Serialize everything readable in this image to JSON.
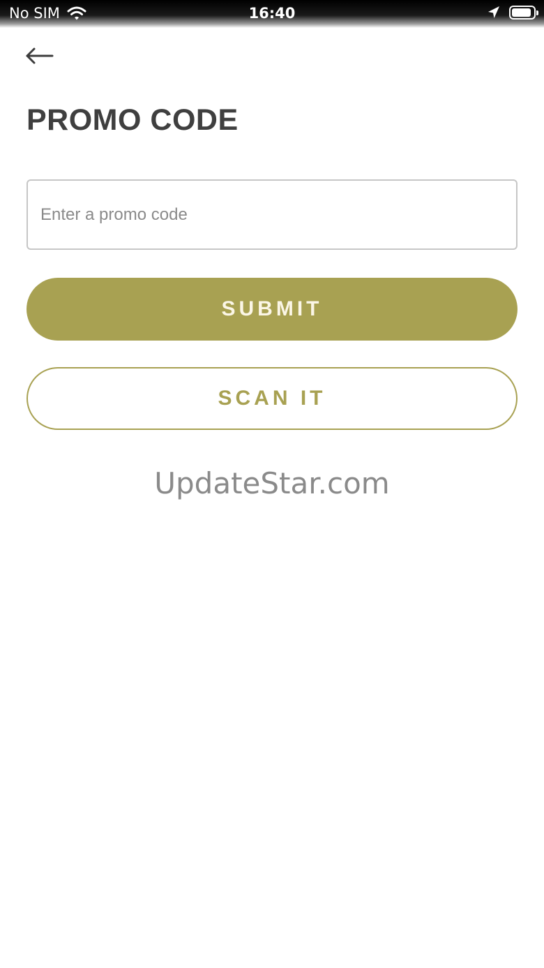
{
  "status_bar": {
    "carrier": "No SIM",
    "time": "16:40",
    "icons": [
      "wifi-icon",
      "location-arrow-icon",
      "battery-icon"
    ]
  },
  "header": {
    "back_icon": "arrow-left-icon",
    "title": "PROMO CODE"
  },
  "form": {
    "promo_input": {
      "value": "",
      "placeholder": "Enter a promo code"
    },
    "submit_label": "SUBMIT",
    "scan_label": "SCAN IT"
  },
  "watermark": "UpdateStar.com",
  "colors": {
    "accent": "#a8a152",
    "title": "#3f3f3f",
    "input_border": "#c6c6c6",
    "placeholder": "#8a8a8a"
  }
}
